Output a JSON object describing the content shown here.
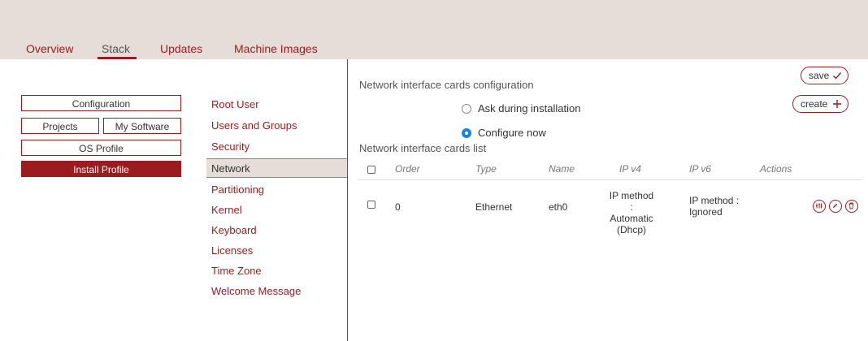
{
  "tabs": [
    {
      "label": "Overview"
    },
    {
      "label": "Stack"
    },
    {
      "label": "Updates"
    },
    {
      "label": "Machine Images"
    }
  ],
  "active_tab": "Stack",
  "left_buttons": {
    "configuration": "Configuration",
    "projects": "Projects",
    "my_software": "My Software",
    "os_profile": "OS Profile",
    "install_profile": "Install Profile"
  },
  "menu": {
    "items": [
      {
        "label": "Root User"
      },
      {
        "label": "Users and Groups"
      },
      {
        "label": "Security"
      },
      {
        "label": "Network"
      },
      {
        "label": "Partitioning"
      },
      {
        "label": "Kernel"
      },
      {
        "label": "Keyboard"
      },
      {
        "label": "Licenses"
      },
      {
        "label": "Time Zone"
      },
      {
        "label": "Welcome Message"
      }
    ],
    "active": "Network"
  },
  "config": {
    "title": "Network interface cards configuration",
    "options": [
      {
        "label": "Ask during installation",
        "selected": false
      },
      {
        "label": "Configure now",
        "selected": true
      }
    ],
    "save_label": "save",
    "create_label": "create"
  },
  "list": {
    "title": "Network interface cards list",
    "columns": [
      "Order",
      "Type",
      "Name",
      "IP v4",
      "IP v6",
      "Actions"
    ],
    "rows": [
      {
        "order": "0",
        "type": "Ethernet",
        "name": "eth0",
        "ipv4": [
          "IP method :",
          "Automatic",
          "(Dhcp)"
        ],
        "ipv6": [
          "IP method :",
          "Ignored"
        ],
        "actions": [
          "settings-icon",
          "edit-icon",
          "delete-icon"
        ]
      }
    ]
  },
  "colors": {
    "accent": "#9b1c1f",
    "topbar": "#e6dcd8",
    "radio_selected": "#1a82e6"
  }
}
